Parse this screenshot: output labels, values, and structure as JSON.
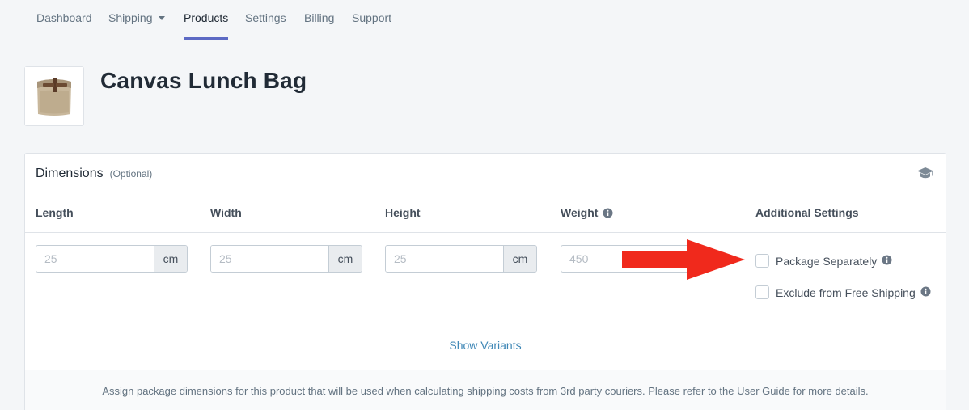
{
  "nav": {
    "items": [
      {
        "label": "Dashboard"
      },
      {
        "label": "Shipping"
      },
      {
        "label": "Products"
      },
      {
        "label": "Settings"
      },
      {
        "label": "Billing"
      },
      {
        "label": "Support"
      }
    ],
    "active": "Products",
    "accent_color": "#5c6ac4"
  },
  "product": {
    "title": "Canvas Lunch Bag",
    "thumbnail_icon": "lunch-bag-image"
  },
  "dimensions": {
    "title": "Dimensions",
    "optional_label": "(Optional)",
    "help_icon": "graduation-cap-icon",
    "columns": {
      "length": "Length",
      "width": "Width",
      "height": "Height",
      "weight": "Weight",
      "additional": "Additional Settings"
    },
    "fields": {
      "length": {
        "placeholder": "25",
        "unit": "cm"
      },
      "width": {
        "placeholder": "25",
        "unit": "cm"
      },
      "height": {
        "placeholder": "25",
        "unit": "cm"
      },
      "weight": {
        "placeholder": "450"
      }
    },
    "settings": {
      "package_separately": "Package Separately",
      "exclude_free_shipping": "Exclude from Free Shipping"
    },
    "show_variants": "Show Variants",
    "footer": "Assign package dimensions for this product that will be used when calculating shipping costs from 3rd party couriers. Please refer to the User Guide for more details.",
    "link_color": "#3d86b5",
    "arrow_color": "#f0291c"
  }
}
